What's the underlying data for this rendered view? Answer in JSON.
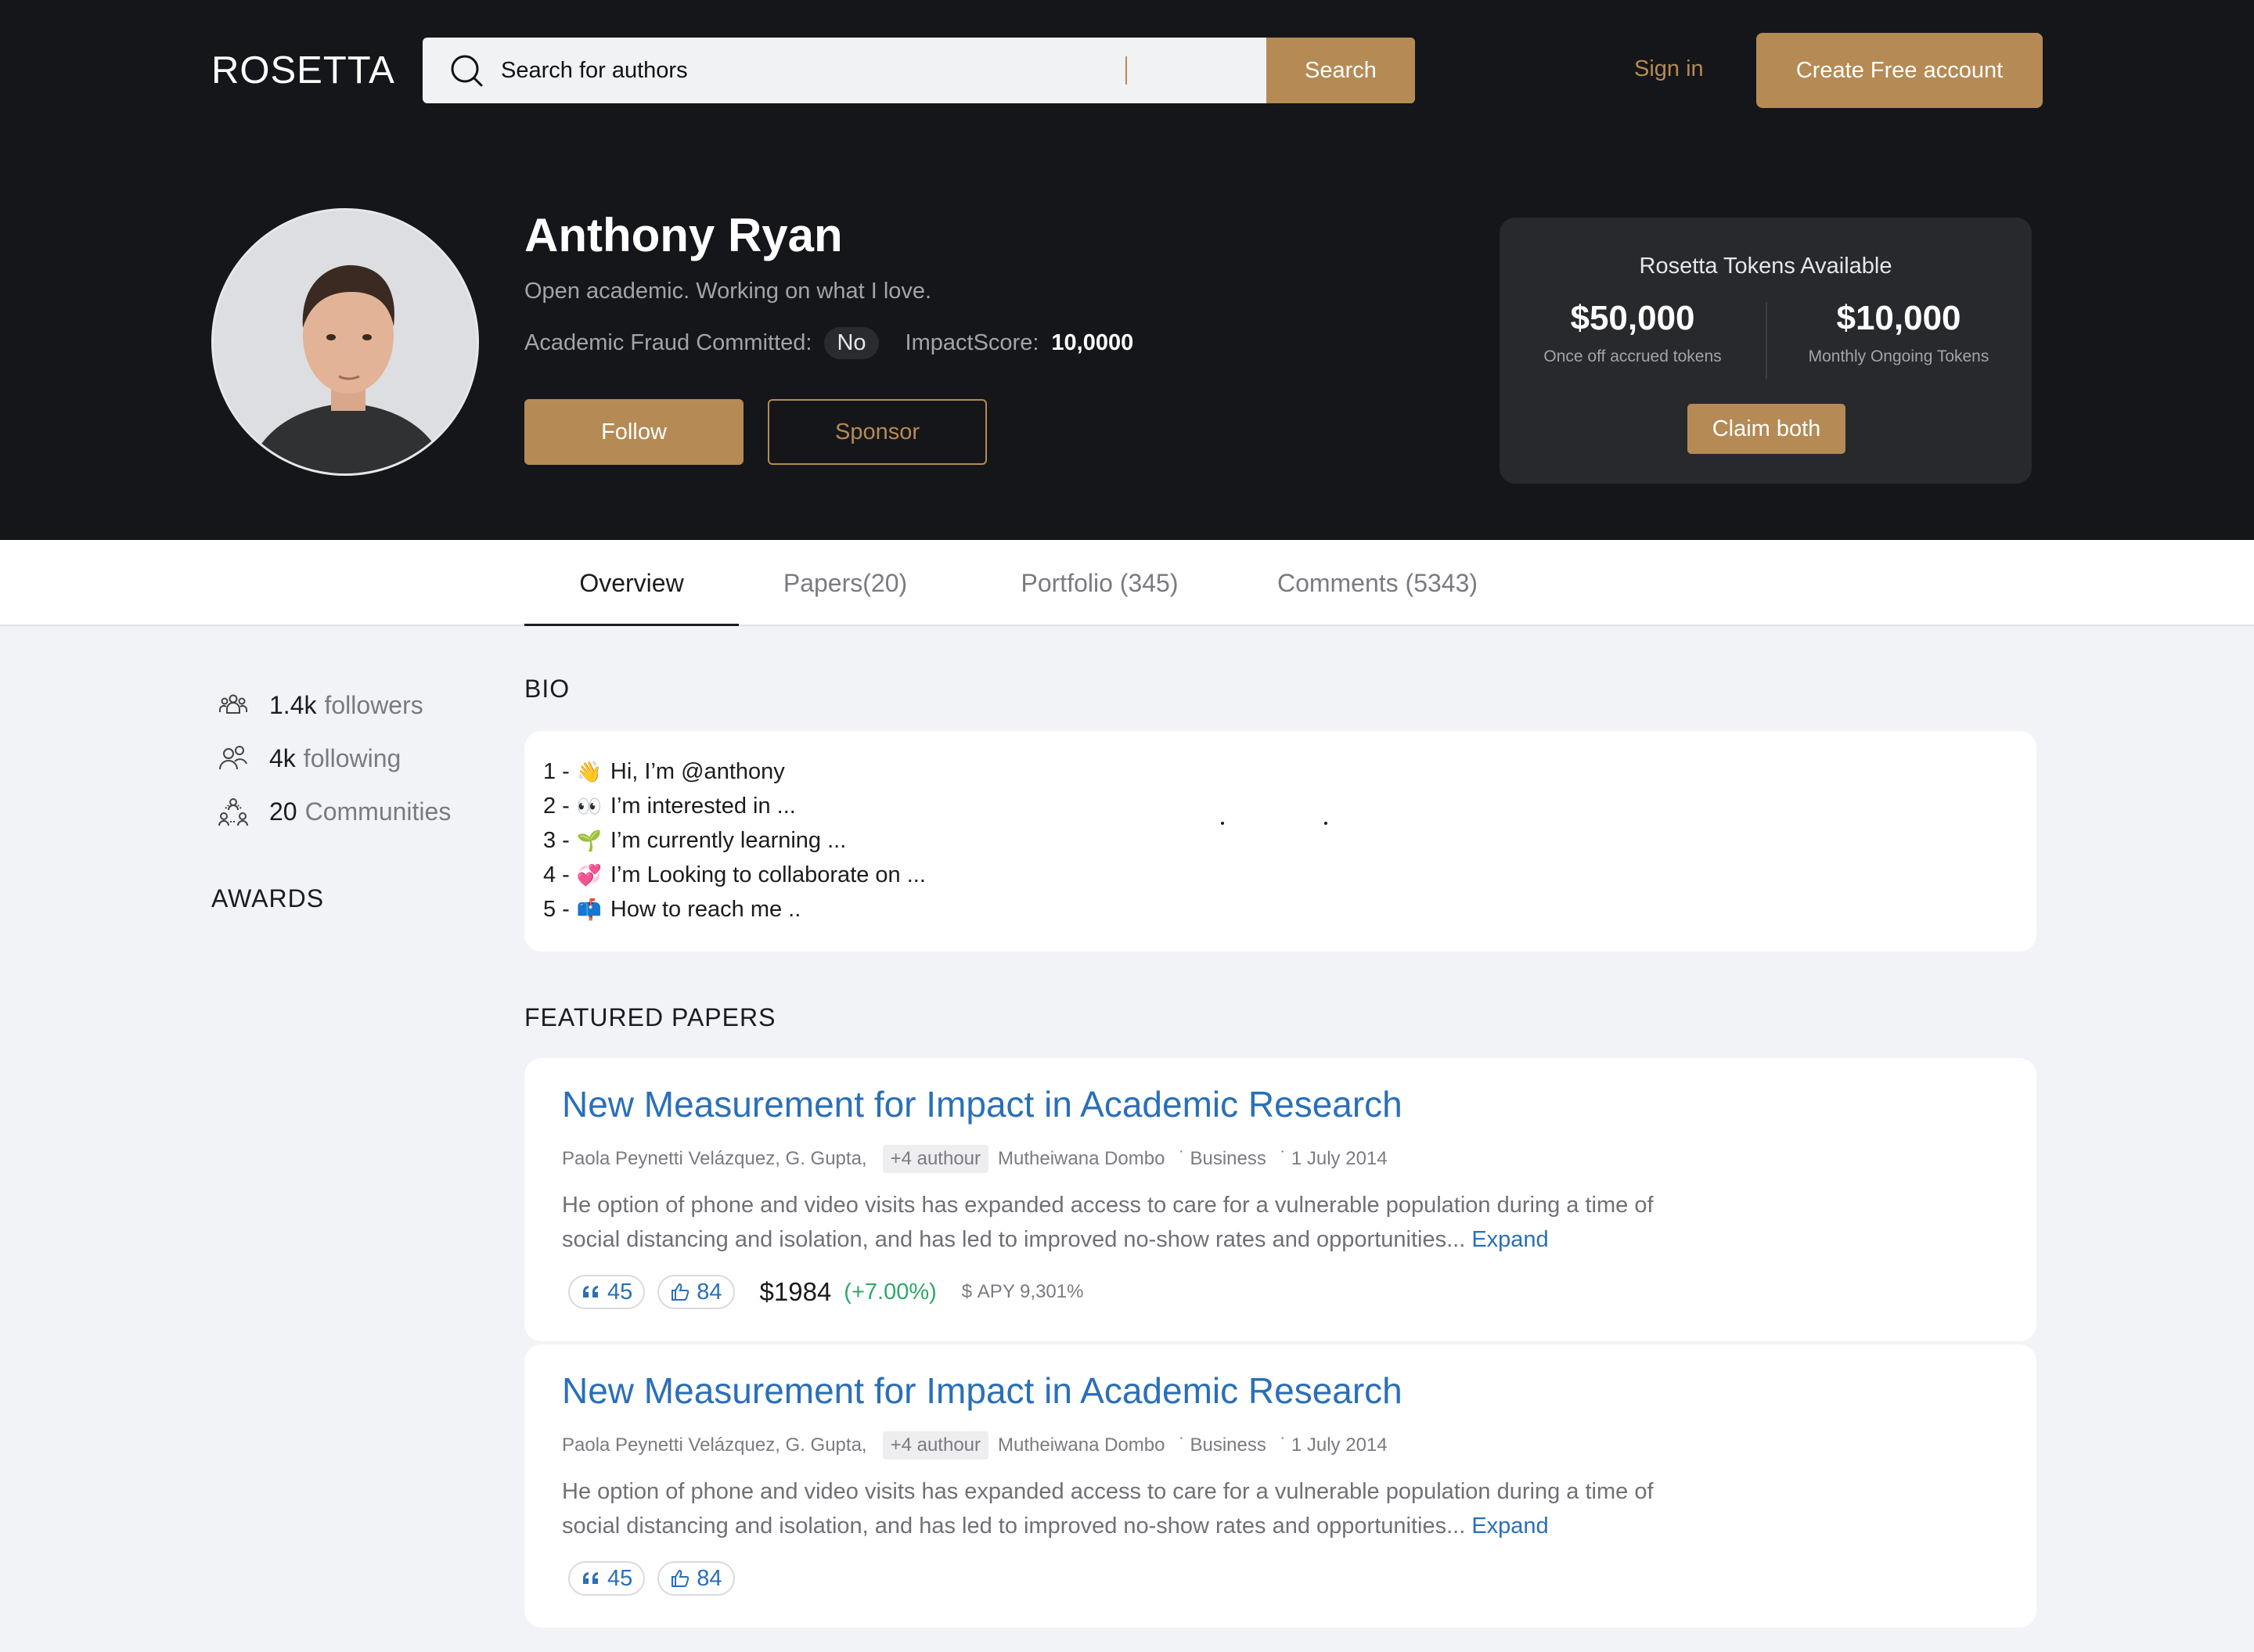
{
  "header": {
    "logo": "ROSETTA",
    "search_placeholder": "Search for authors",
    "search_button": "Search",
    "sign_in": "Sign in",
    "create_account": "Create Free account"
  },
  "profile": {
    "name": "Anthony Ryan",
    "tagline": "Open academic. Working on what I love.",
    "fraud_label": "Academic Fraud Committed:",
    "fraud_value": "No",
    "impact_label": "ImpactScore:",
    "impact_value": "10,0000",
    "follow": "Follow",
    "sponsor": "Sponsor"
  },
  "tokens": {
    "title": "Rosetta Tokens Available",
    "once_amount": "$50,000",
    "once_label": "Once off accrued tokens",
    "monthly_amount": "$10,000",
    "monthly_label": "Monthly Ongoing Tokens",
    "claim": "Claim both"
  },
  "tabs": [
    {
      "label": "Overview",
      "active": true
    },
    {
      "label": "Papers(20)",
      "active": false
    },
    {
      "label": "Portfolio (345)",
      "active": false
    },
    {
      "label": "Comments (5343)",
      "active": false
    }
  ],
  "sidebar": {
    "stats": [
      {
        "number": "1.4k",
        "label": "followers",
        "icon": "followers-icon"
      },
      {
        "number": "4k",
        "label": "following",
        "icon": "following-icon"
      },
      {
        "number": "20",
        "label": "Communities",
        "icon": "communities-icon"
      }
    ],
    "awards_heading": "AWARDS"
  },
  "bio": {
    "heading": "BIO",
    "lines": [
      {
        "prefix": "1 -",
        "emoji": "👋",
        "text": "Hi, I’m @anthony"
      },
      {
        "prefix": "2 -",
        "emoji": "👀",
        "text": "I’m interested in ..."
      },
      {
        "prefix": "3 -",
        "emoji": "🌱",
        "text": "I’m currently learning ..."
      },
      {
        "prefix": "4 -",
        "emoji": "💞",
        "text": "I’m Looking to collaborate on ..."
      },
      {
        "prefix": "5 -",
        "emoji": "📫",
        "text": "How to reach me .."
      }
    ]
  },
  "featured": {
    "heading": "FEATURED PAPERS",
    "papers": [
      {
        "title": "New Measurement for Impact in Academic Research",
        "authors": "Paola Peynetti Velázquez, G. Gupta,",
        "more_authors": "+4 authour",
        "last_author": "Mutheiwana Dombo",
        "category": "Business",
        "date": "1 July 2014",
        "abstract": "He option of phone and video visits has expanded access to care for a vulnerable population during a time of social distancing and isolation, and has led to improved no-show rates and opportunities...",
        "expand": "Expand",
        "quotes": "45",
        "likes": "84",
        "price": "$1984",
        "change": "(+7.00%)",
        "apy": "APY 9,301%"
      },
      {
        "title": "New Measurement for Impact in Academic Research",
        "authors": "Paola Peynetti Velázquez, G. Gupta,",
        "more_authors": "+4 authour",
        "last_author": "Mutheiwana Dombo",
        "category": "Business",
        "date": "1 July 2014",
        "abstract": "He option of phone and video visits has expanded access to care for a vulnerable population during a time of social distancing and isolation, and has led to improved no-show rates and opportunities...",
        "expand": "Expand",
        "quotes": "45",
        "likes": "84"
      }
    ]
  },
  "colors": {
    "accent": "#b58a55",
    "dark_bg": "#151619",
    "link": "#2a6fb8",
    "positive": "#2fa86a"
  }
}
